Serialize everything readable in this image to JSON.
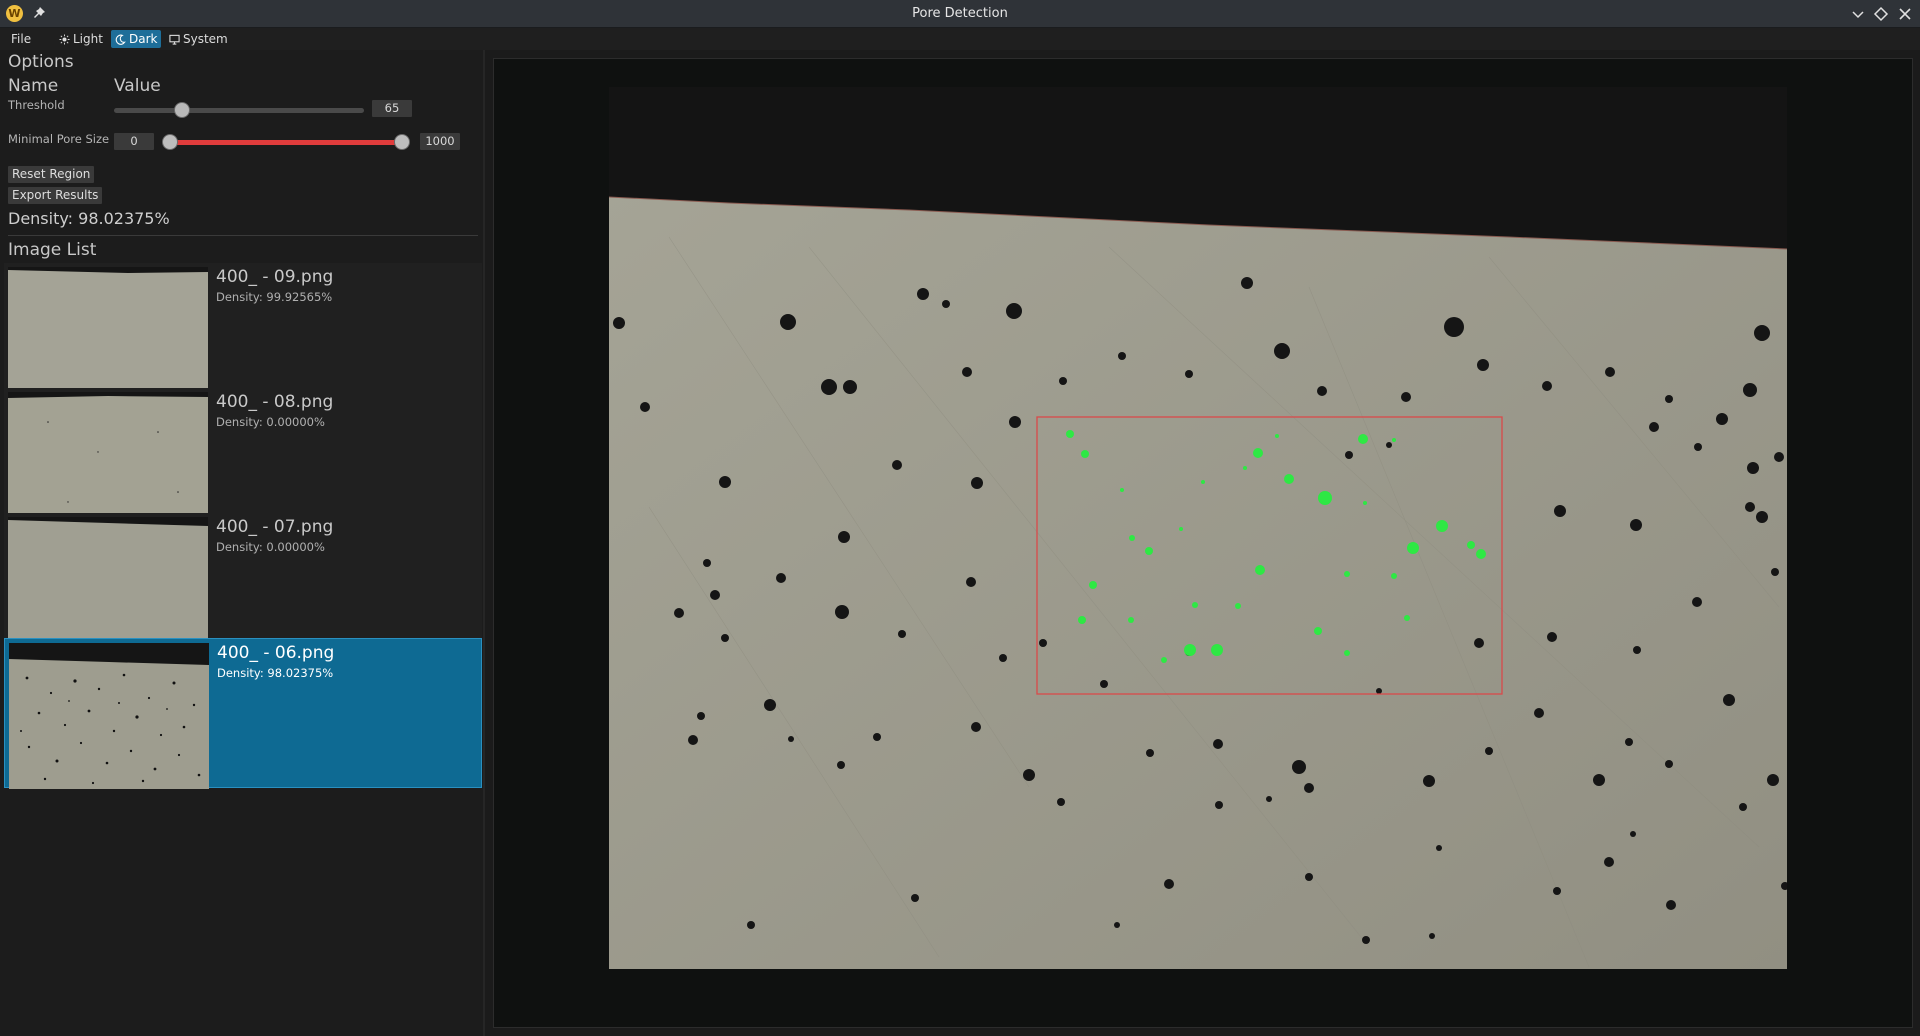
{
  "window": {
    "title": "Pore Detection",
    "app_icon_letter": "W"
  },
  "menu": {
    "file": "File",
    "themes": [
      {
        "label": "Light",
        "icon": "sun-icon"
      },
      {
        "label": "Dark",
        "icon": "moon-icon",
        "selected": true
      },
      {
        "label": "System",
        "icon": "monitor-icon"
      }
    ]
  },
  "options": {
    "header": "Options",
    "col_name": "Name",
    "col_value": "Value",
    "threshold": {
      "label": "Threshold",
      "value": "65",
      "fraction": 0.27
    },
    "min_pore_size": {
      "label": "Minimal Pore Size",
      "min": "0",
      "max": "1000",
      "low_fraction": 0.0,
      "high_fraction": 1.0
    },
    "reset_button": "Reset Region",
    "export_button": "Export Results",
    "density": "Density: 98.02375%"
  },
  "image_list": {
    "header": "Image List",
    "items": [
      {
        "name": "400_ - 09.png",
        "density": "Density: 99.92565%",
        "selected": false
      },
      {
        "name": "400_ - 08.png",
        "density": "Density: 0.00000%",
        "selected": false
      },
      {
        "name": "400_ - 07.png",
        "density": "Density: 0.00000%",
        "selected": false
      },
      {
        "name": "400_ - 06.png",
        "density": "Density: 98.02375%",
        "selected": true
      }
    ]
  },
  "colors": {
    "accent": "#0e6a93",
    "range_track": "#e03c3c",
    "region_box": "#d94a4a",
    "detected_pore": "#2ee844",
    "sample_surface": "#9c9b8d",
    "pore": "#141414"
  }
}
